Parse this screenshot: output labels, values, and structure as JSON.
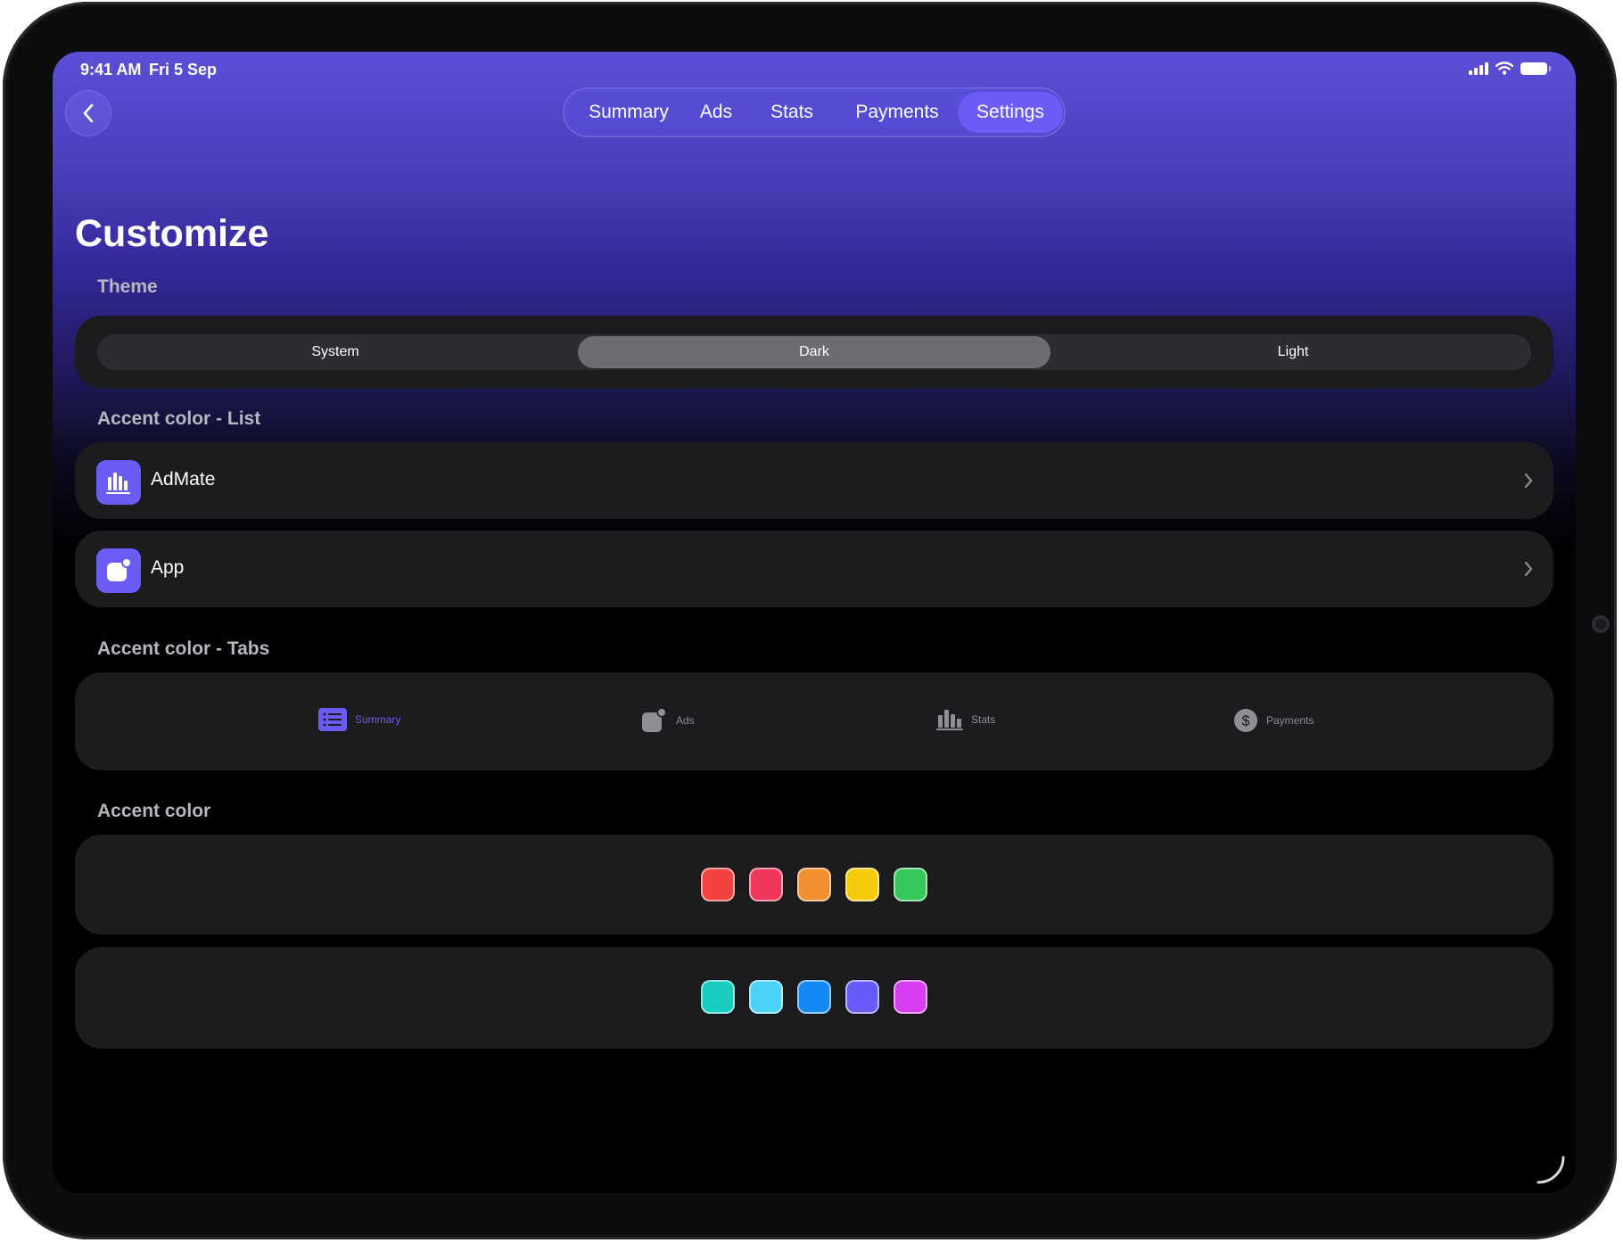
{
  "status_bar": {
    "time": "9:41 AM",
    "date": "Fri 5 Sep"
  },
  "nav": {
    "back_icon": "chevron-left-icon",
    "tabs": [
      {
        "label": "Summary",
        "active": false
      },
      {
        "label": "Ads",
        "active": false
      },
      {
        "label": "Stats",
        "active": false
      },
      {
        "label": "Payments",
        "active": false
      },
      {
        "label": "Settings",
        "active": true
      }
    ]
  },
  "page": {
    "title": "Customize"
  },
  "theme": {
    "section_label": "Theme",
    "options": [
      "System",
      "Dark",
      "Light"
    ],
    "selected": "Dark"
  },
  "accent_list": {
    "section_label": "Accent color - List",
    "items": [
      {
        "label": "AdMate",
        "icon": "bar-chart-icon"
      },
      {
        "label": "App",
        "icon": "app-badge-icon"
      }
    ]
  },
  "accent_tabs": {
    "section_label": "Accent color - Tabs",
    "items": [
      {
        "label": "Summary",
        "icon": "list-icon",
        "active": true
      },
      {
        "label": "Ads",
        "icon": "app-badge-icon",
        "active": false
      },
      {
        "label": "Stats",
        "icon": "bar-chart-icon",
        "active": false
      },
      {
        "label": "Payments",
        "icon": "dollar-circle-icon",
        "active": false
      }
    ]
  },
  "accent_color": {
    "section_label": "Accent color",
    "rows": [
      [
        "#f5423e",
        "#f0365a",
        "#f28f30",
        "#f5cc0a",
        "#35c75a"
      ],
      [
        "#16cdbf",
        "#4bd2f7",
        "#1489f5",
        "#675cf7",
        "#d63ef0"
      ]
    ]
  },
  "colors": {
    "accent": "#6a5cf5"
  }
}
